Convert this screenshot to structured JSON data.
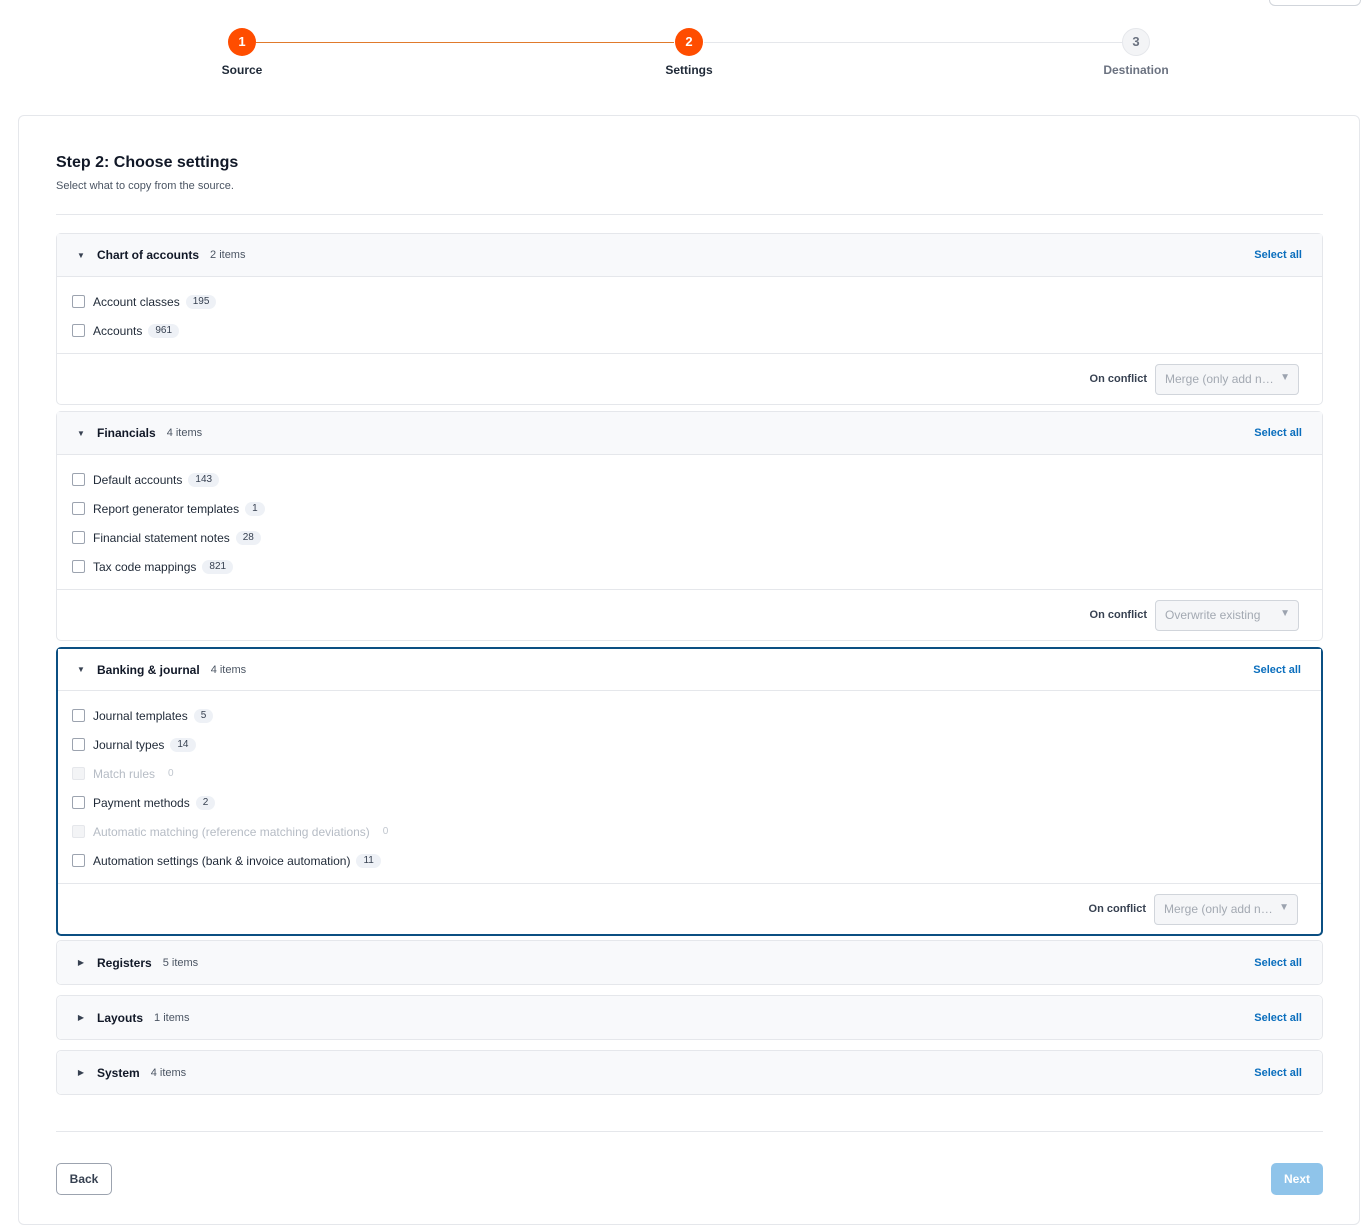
{
  "stepper": {
    "steps": [
      {
        "number": "1",
        "label": "Source",
        "state": "completed"
      },
      {
        "number": "2",
        "label": "Settings",
        "state": "active"
      },
      {
        "number": "3",
        "label": "Destination",
        "state": "upcoming"
      }
    ]
  },
  "header": {
    "title": "Step 2: Choose settings",
    "subtitle": "Select what to copy from the source."
  },
  "select_all_label": "Select all",
  "conflict_label": "On conflict",
  "sections": [
    {
      "title": "Chart of accounts",
      "count": "2 items",
      "expanded": true,
      "items": [
        {
          "label": "Account classes",
          "count": "195"
        },
        {
          "label": "Accounts",
          "count": "961"
        }
      ],
      "conflict_value": "Merge (only add new)"
    },
    {
      "title": "Financials",
      "count": "4 items",
      "expanded": true,
      "items": [
        {
          "label": "Default accounts",
          "count": "143"
        },
        {
          "label": "Report generator templates",
          "count": "1"
        },
        {
          "label": "Financial statement notes",
          "count": "28"
        },
        {
          "label": "Tax code mappings",
          "count": "821"
        }
      ],
      "conflict_value": "Overwrite existing"
    },
    {
      "title": "Banking & journal",
      "count": "4 items",
      "expanded": true,
      "items": [
        {
          "label": "Journal templates",
          "count": "5"
        },
        {
          "label": "Journal types",
          "count": "14"
        },
        {
          "label": "Match rules",
          "count": "0",
          "disabled": true
        },
        {
          "label": "Payment methods",
          "count": "2"
        },
        {
          "label": "Automatic matching (reference matching deviations)",
          "count": "0",
          "disabled": true
        },
        {
          "label": "Automation settings (bank & invoice automation)",
          "count": "11"
        }
      ],
      "conflict_value": "Merge (only add new)"
    },
    {
      "title": "Registers",
      "count": "5 items",
      "expanded": false
    },
    {
      "title": "Layouts",
      "count": "1 items",
      "expanded": false
    },
    {
      "title": "System",
      "count": "4 items",
      "expanded": false
    }
  ],
  "footer": {
    "back_label": "Back",
    "next_label": "Next"
  },
  "colors": {
    "accent": "#ff4d00",
    "progress_line": "#e07a2c",
    "link": "#0a6ebd",
    "focus_border": "#0b4f82",
    "next_disabled": "#8fc4ea"
  },
  "icons": {
    "expanded": "caret-down-icon",
    "collapsed": "caret-right-icon",
    "select": "dropdown-arrow-icon"
  }
}
